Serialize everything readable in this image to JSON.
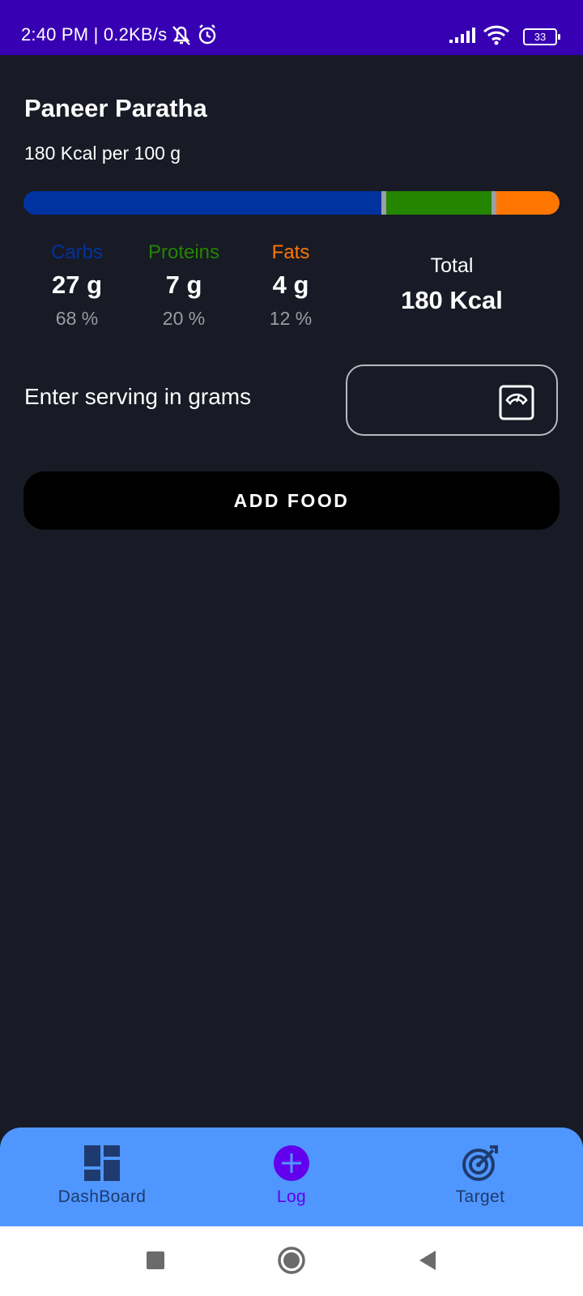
{
  "status_bar": {
    "time_text": "2:40 PM | 0.2KB/s",
    "battery": "33",
    "background": "#3700b3"
  },
  "food": {
    "name": "Paneer Paratha",
    "kcal_per": "180 Kcal per 100 g"
  },
  "macros_bar": {
    "carbs_fraction": 0.68,
    "proteins_fraction": 0.2,
    "fats_fraction": 0.12,
    "carbs_color": "#0033a0",
    "proteins_color": "#238500",
    "fats_color": "#ff7700"
  },
  "macros": [
    {
      "label": "Carbs",
      "grams": "27 g",
      "percent": "68 %",
      "color": "#0033a0"
    },
    {
      "label": "Proteins",
      "grams": "7 g",
      "percent": "20 %",
      "color": "#238500"
    },
    {
      "label": "Fats",
      "grams": "4 g",
      "percent": "12 %",
      "color": "#ff7700"
    }
  ],
  "total": {
    "label": "Total",
    "value": "180 Kcal"
  },
  "serving": {
    "label": "Enter serving in grams",
    "value": "",
    "icon": "scale-icon"
  },
  "add_food_button": "ADD FOOD",
  "bottom_nav": {
    "items": [
      {
        "label": "DashBoard",
        "icon": "dashboard-icon",
        "color": "#1e3a6e"
      },
      {
        "label": "Log",
        "icon": "add-circle-icon",
        "color": "#6200ee"
      },
      {
        "label": "Target",
        "icon": "target-icon",
        "color": "#1e3a6e"
      }
    ],
    "background": "#4f97ff"
  },
  "system_nav": {
    "icons": [
      "recents-square-icon",
      "home-circle-icon",
      "back-triangle-icon"
    ]
  }
}
